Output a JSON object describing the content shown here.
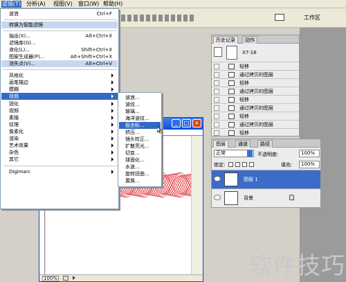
{
  "menubar": {
    "items": [
      {
        "label": "滤镜(T)",
        "active": true
      },
      {
        "label": "分析(A)"
      },
      {
        "label": "视图(V)"
      },
      {
        "label": "窗口(W)"
      },
      {
        "label": "帮助(H)"
      }
    ]
  },
  "options_bar": {
    "workspace_label": "工作区"
  },
  "filter_menu": {
    "last_filter": {
      "label": "波浪",
      "shortcut": "Ctrl+F"
    },
    "convert_smart": "转换为智能滤镜",
    "group1": [
      {
        "label": "抽出(X)...",
        "shortcut": "Alt+Ctrl+X"
      },
      {
        "label": "滤镜库(G)..."
      },
      {
        "label": "液化(L)...",
        "shortcut": "Shift+Ctrl+X"
      },
      {
        "label": "图案生成器(P)...",
        "shortcut": "Alt+Shift+Ctrl+X"
      },
      {
        "label": "消失点(V)...",
        "shortcut": "Alt+Ctrl+V"
      }
    ],
    "group2": [
      "风格化",
      "画笔描边",
      "模糊",
      "扭曲",
      "锐化",
      "视频",
      "素描",
      "纹理",
      "像素化",
      "渲染",
      "艺术效果",
      "杂色",
      "其它"
    ],
    "digimarc": "Digimarc"
  },
  "distort_submenu": {
    "items": [
      "波浪...",
      "波纹...",
      "玻璃...",
      "海洋波纹...",
      "极坐标...",
      "挤压...",
      "镜头校正...",
      "扩散亮光...",
      "切变...",
      "球面化...",
      "水波...",
      "旋转扭曲...",
      "置换..."
    ],
    "highlighted_index": 4
  },
  "document": {
    "zoom": "100%"
  },
  "history_panel": {
    "tabs": [
      "历史记录",
      "动作"
    ],
    "snapshot": "X7-16",
    "steps": [
      "轻移",
      "通过拷贝的图层",
      "轻移",
      "通过拷贝的图层",
      "轻移",
      "通过拷贝的图层",
      "轻移",
      "通过拷贝的图层",
      "轻移"
    ]
  },
  "layers_panel": {
    "tabs": [
      "图层",
      "通道",
      "路径"
    ],
    "blend_mode": "正常",
    "opacity_label": "不透明度:",
    "opacity": "100%",
    "lock_label": "锁定:",
    "fill_label": "填充:",
    "fill": "100%",
    "layers": [
      {
        "name": "图层 1",
        "selected": true
      },
      {
        "name": "背景",
        "selected": false,
        "locked": true
      }
    ]
  },
  "watermark": "软件技巧",
  "colors": {
    "selection": "#316ac5",
    "wave": "#e0202a"
  }
}
